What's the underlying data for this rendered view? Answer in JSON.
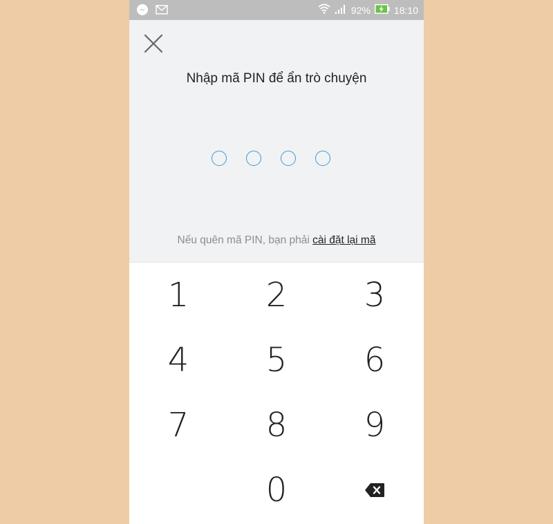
{
  "status_bar": {
    "battery_percent": "92%",
    "time": "18:10",
    "icons": [
      "messenger-icon",
      "email-icon",
      "wifi-icon",
      "signal-icon",
      "battery-charging-icon"
    ]
  },
  "header": {
    "close_icon": "close-icon",
    "title": "Nhập mã PIN để ẩn trò chuyện"
  },
  "pin": {
    "length": 4,
    "entered": 0
  },
  "hint": {
    "text": "Nếu quên mã PIN, bạn phải ",
    "link": "cài đặt lại mã"
  },
  "keypad": {
    "keys": [
      "1",
      "2",
      "3",
      "4",
      "5",
      "6",
      "7",
      "8",
      "9",
      "",
      "0",
      "backspace"
    ],
    "backspace_icon": "backspace-icon"
  },
  "colors": {
    "accent": "#3D9AD1",
    "background": "#EECCA5",
    "screen": "#F1F2F4",
    "status_bar": "#BDBDBD",
    "battery_green": "#6CC24A"
  }
}
